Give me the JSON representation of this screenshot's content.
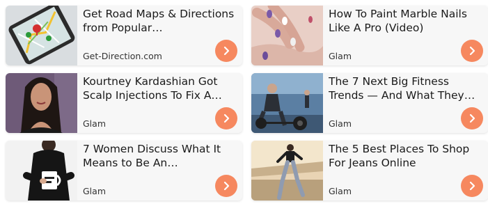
{
  "accent_color": "#f6885f",
  "cards": [
    {
      "title": "Get Road Maps & Directions from Popular…",
      "source": "Get-Direction.com",
      "thumb_icon": "map-phone-thumbnail"
    },
    {
      "title": "How To Paint Marble Nails Like A Pro (Video)",
      "source": "Glam",
      "thumb_icon": "nails-thumbnail"
    },
    {
      "title": "Kourtney Kardashian Got Scalp Injections To Fix A…",
      "source": "Glam",
      "thumb_icon": "portrait-thumbnail"
    },
    {
      "title": "The 7 Next Big Fitness Trends — And What They…",
      "source": "Glam",
      "thumb_icon": "gym-thumbnail"
    },
    {
      "title": "7 Women Discuss What It Means to Be An…",
      "source": "Glam",
      "thumb_icon": "mug-thumbnail"
    },
    {
      "title": "The 5 Best Places To Shop For Jeans Online",
      "source": "Glam",
      "thumb_icon": "jeans-thumbnail"
    }
  ]
}
